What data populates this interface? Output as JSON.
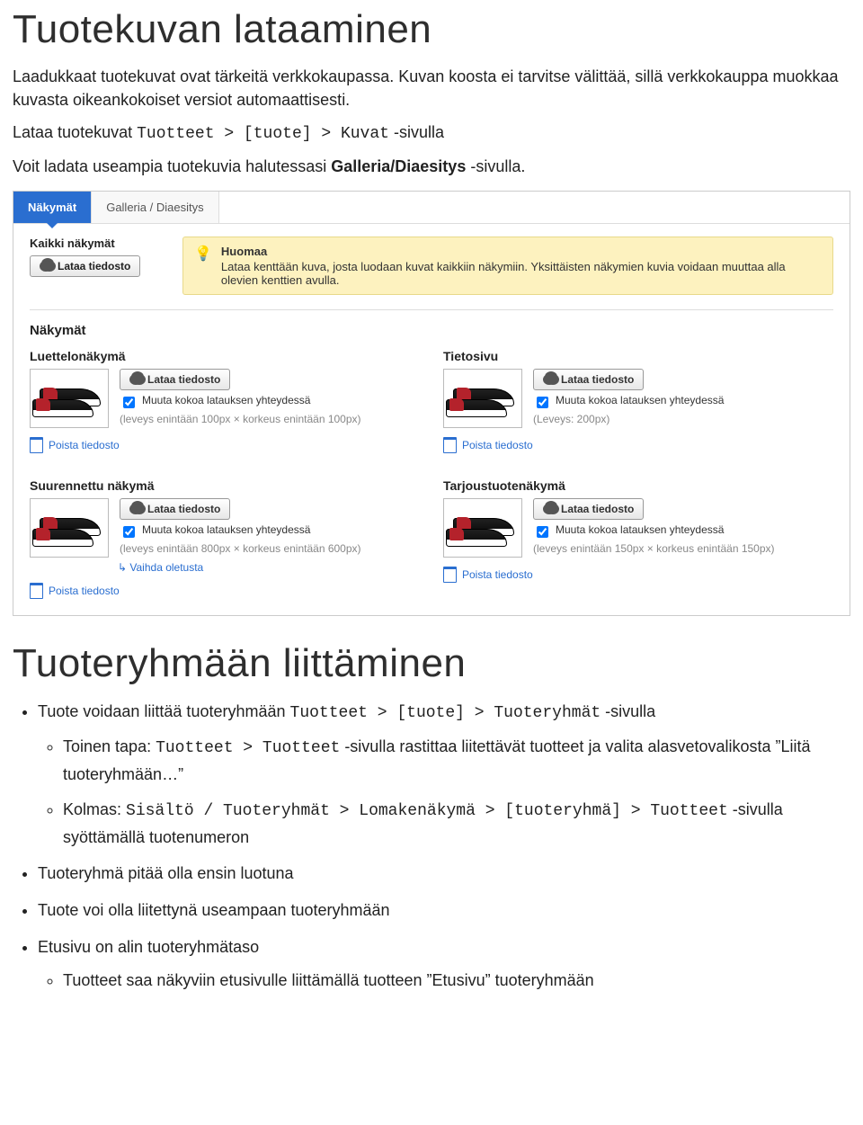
{
  "h1a": "Tuotekuvan lataaminen",
  "p1": "Laadukkaat tuotekuvat ovat tärkeitä verkkokaupassa. Kuvan koosta ei tarvitse välittää, sillä verkkokauppa muokkaa kuvasta oikeankokoiset versiot automaattisesti.",
  "p2a": "Lataa tuotekuvat ",
  "p2code": "Tuotteet > [tuote] > Kuvat",
  "p2b": " -sivulla",
  "p3a": "Voit ladata useampia tuotekuvia halutessasi ",
  "p3bold": "Galleria/Diaesitys",
  "p3b": " -sivulla.",
  "tabs": {
    "active": "Näkymät",
    "other": "Galleria / Diaesitys"
  },
  "kaikki": {
    "title": "Kaikki näkymät",
    "btn": "Lataa tiedosto"
  },
  "notice": {
    "title": "Huomaa",
    "body": "Lataa kenttään kuva, josta luodaan kuvat kaikkiin näkymiin. Yksittäisten näkymien kuvia voidaan muuttaa alla olevien kenttien avulla."
  },
  "section": "Näkymät",
  "views": [
    {
      "title": "Luettelonäkymä",
      "btn": "Lataa tiedosto",
      "chk": "Muuta kokoa latauksen yhteydessä",
      "dim": "(leveys enintään 100px × korkeus enintään 100px)",
      "del": "Poista tiedosto",
      "swap": ""
    },
    {
      "title": "Tietosivu",
      "btn": "Lataa tiedosto",
      "chk": "Muuta kokoa latauksen yhteydessä",
      "dim": "(Leveys: 200px)",
      "del": "Poista tiedosto",
      "swap": ""
    },
    {
      "title": "Suurennettu näkymä",
      "btn": "Lataa tiedosto",
      "chk": "Muuta kokoa latauksen yhteydessä",
      "dim": "(leveys enintään 800px × korkeus enintään 600px)",
      "del": "Poista tiedosto",
      "swap": "Vaihda oletusta"
    },
    {
      "title": "Tarjoustuotenäkymä",
      "btn": "Lataa tiedosto",
      "chk": "Muuta kokoa latauksen yhteydessä",
      "dim": "(leveys enintään 150px × korkeus enintään 150px)",
      "del": "Poista tiedosto",
      "swap": ""
    }
  ],
  "h1b": "Tuoteryhmään liittäminen",
  "b1a": "Tuote voidaan liittää tuoteryhmään ",
  "b1code": "Tuotteet > [tuote] > Tuoteryhmät",
  "b1b": " -sivulla",
  "b1s1a": "Toinen tapa: ",
  "b1s1code": "Tuotteet > Tuotteet",
  "b1s1b": " -sivulla rastittaa liitettävät tuotteet ja valita alasvetovalikosta ”Liitä tuoteryhmään…”",
  "b1s2a": "Kolmas: ",
  "b1s2code": "Sisältö / Tuoteryhmät > Lomakenäkymä > [tuoteryhmä] > Tuotteet",
  "b1s2b": " -sivulla syöttämällä tuotenumeron",
  "b2": "Tuoteryhmä pitää olla ensin luotuna",
  "b3": "Tuote voi olla liitettynä useampaan tuoteryhmään",
  "b4": "Etusivu on alin tuoteryhmätaso",
  "b4s1": "Tuotteet saa näkyviin etusivulle liittämällä tuotteen ”Etusivu” tuoteryhmään"
}
